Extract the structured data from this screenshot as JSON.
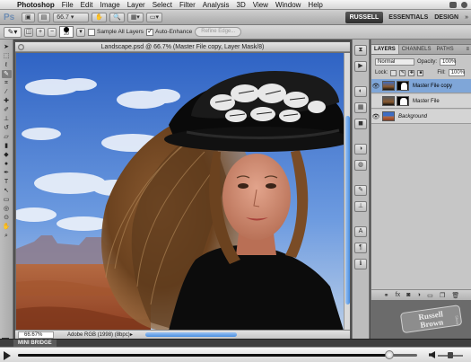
{
  "menubar": {
    "app_name": "Photoshop",
    "items": [
      "File",
      "Edit",
      "Image",
      "Layer",
      "Select",
      "Filter",
      "Analysis",
      "3D",
      "View",
      "Window",
      "Help"
    ]
  },
  "appbar": {
    "logo": "Ps",
    "zoom": "66.7",
    "workspaces": {
      "active": "RUSSELL",
      "others": [
        "ESSENTIALS",
        "DESIGN"
      ],
      "more": "»"
    }
  },
  "options": {
    "brush_size": "20",
    "sample_all_layers": {
      "label": "Sample All Layers",
      "checked": false
    },
    "auto_enhance": {
      "label": "Auto-Enhance",
      "checked": true
    },
    "refine_edge": "Refine Edge..."
  },
  "document": {
    "title": "Landscape.psd @ 66.7% (Master File copy, Layer Mask/8)",
    "zoom_field": "66.67%",
    "status": "Adobe RGB (1998) (8bpc)"
  },
  "layers_panel": {
    "tabs": [
      "LAYERS",
      "CHANNELS",
      "PATHS"
    ],
    "active_tab": "LAYERS",
    "blend_mode": "Normal",
    "opacity_label": "Opacity:",
    "opacity": "100%",
    "lock_label": "Lock:",
    "fill_label": "Fill:",
    "fill": "100%",
    "layers": [
      {
        "name": "Master File copy",
        "selected": true,
        "visible": true
      },
      {
        "name": "Master File",
        "selected": false,
        "visible": false
      },
      {
        "name": "Background",
        "selected": false,
        "visible": true,
        "italic": true
      }
    ]
  },
  "bottom": {
    "mini_bridge_label": "MINI BRIDGE",
    "progress_fraction": 0.93
  },
  "watermark": "Russell Brown Show",
  "colors": {
    "selection_blue": "#7fa6d8",
    "scroll_blue": "#4a8fe0"
  }
}
